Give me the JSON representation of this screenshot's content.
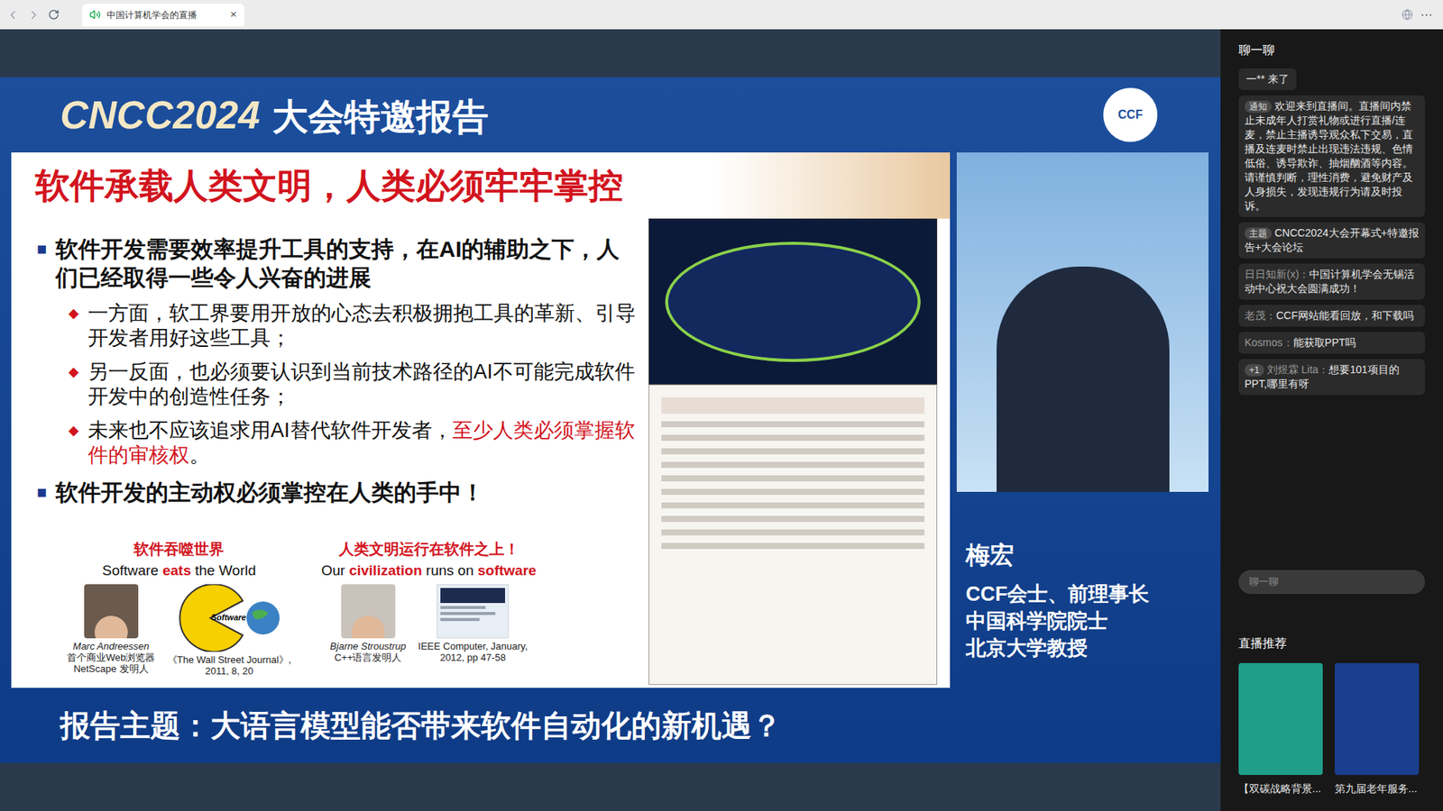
{
  "browser": {
    "tab_title": "中国计算机学会的直播",
    "tab_close": "×",
    "menu": "···"
  },
  "stream": {
    "banner": {
      "brand": "CNCC2024",
      "title": "大会特邀报告",
      "logo": "CCF"
    },
    "slide": {
      "title": "软件承载人类文明，人类必须牢牢掌控",
      "bullets": [
        {
          "mark": "■",
          "text": "软件开发需要效率提升工具的支持，在AI的辅助之下，人们已经取得一些令人兴奋的进展",
          "subs": [
            {
              "mark": "◆",
              "parts": [
                {
                  "text": "一方面，软工界要用开放的心态去积极拥抱工具的革新、引导开发者用好这些工具；",
                  "red": false
                }
              ]
            },
            {
              "mark": "◆",
              "parts": [
                {
                  "text": "另一反面，也必须要认识到当前技术路径的AI不可能完成软件开发中的创造性任务；",
                  "red": false
                }
              ]
            },
            {
              "mark": "◆",
              "parts": [
                {
                  "text": "未来也不应该追求用AI替代软件开发者，",
                  "red": false
                },
                {
                  "text": "至少人类必须掌握软件的审核权",
                  "red": true
                },
                {
                  "text": "。",
                  "red": false
                }
              ]
            }
          ]
        },
        {
          "mark": "■",
          "text": "软件开发的主动权必须掌控在人类的手中！",
          "subs": []
        }
      ],
      "quotes": [
        {
          "heading": "软件吞噬世界",
          "motto": [
            {
              "text": "Software ",
              "red": false
            },
            {
              "text": "eats",
              "red": true
            },
            {
              "text": " the World",
              "red": false
            }
          ],
          "figures": [
            {
              "kind": "photo",
              "label": "",
              "lines": [
                "Marc Andreessen",
                "首个商业Web浏览器",
                "NetScape 发明人"
              ]
            },
            {
              "kind": "pacman",
              "label": "Software",
              "lines": [
                "《The Wall Street Journal》,",
                "2011, 8, 20"
              ]
            }
          ]
        },
        {
          "heading": "人类文明运行在软件之上！",
          "motto": [
            {
              "text": "Our ",
              "red": false
            },
            {
              "text": "civilization",
              "red": true
            },
            {
              "text": " runs on ",
              "red": false
            },
            {
              "text": "software",
              "red": true
            }
          ],
          "figures": [
            {
              "kind": "photo",
              "label": "",
              "lines": [
                "Bjarne Stroustrup",
                "C++语言发明人"
              ]
            },
            {
              "kind": "doc",
              "label": "",
              "lines": [
                "IEEE Computer, January,",
                "2012, pp 47-58"
              ]
            }
          ]
        }
      ]
    },
    "speaker": {
      "name": "梅宏",
      "titles": [
        "CCF会士、前理事长",
        "中国科学院院士",
        "北京大学教授"
      ]
    },
    "topic": "报告主题：大语言模型能否带来软件自动化的新机遇？"
  },
  "chat": {
    "title": "聊一聊",
    "messages": [
      {
        "kind": "enter",
        "tag": "",
        "name": "",
        "text": "一** 来了"
      },
      {
        "kind": "notice",
        "tag": "通知",
        "name": "",
        "text": "欢迎来到直播间。直播间内禁止未成年人打赏礼物或进行直播/连麦，禁止主播诱导观众私下交易，直播及连麦时禁止出现违法违规、色情低俗、诱导欺诈、抽烟酗酒等内容。请谨慎判断，理性消费，避免财产及人身损失，发现违规行为请及时投诉。"
      },
      {
        "kind": "notice",
        "tag": "主题",
        "name": "",
        "text": "CNCC2024大会开幕式+特邀报告+大会论坛"
      },
      {
        "kind": "message",
        "tag": "",
        "name": "日日知新(x)：",
        "text": "中国计算机学会无锡活动中心祝大会圆满成功！"
      },
      {
        "kind": "message",
        "tag": "",
        "name": "老茂：",
        "text": "CCF网站能看回放，和下载吗"
      },
      {
        "kind": "message",
        "tag": "",
        "name": "Kosmos：",
        "text": "能获取PPT吗"
      },
      {
        "kind": "message",
        "tag": "+1",
        "name": "刘煜霖 Lita：",
        "text": "想要101项目的PPT,哪里有呀"
      }
    ],
    "input_placeholder": "聊一聊",
    "recommend_title": "直播推荐",
    "recommend": [
      {
        "caption": "【双碳战略背景...",
        "color": "#1f9e8a"
      },
      {
        "caption": "第九届老年服务...",
        "color": "#1b3f8f"
      }
    ]
  }
}
